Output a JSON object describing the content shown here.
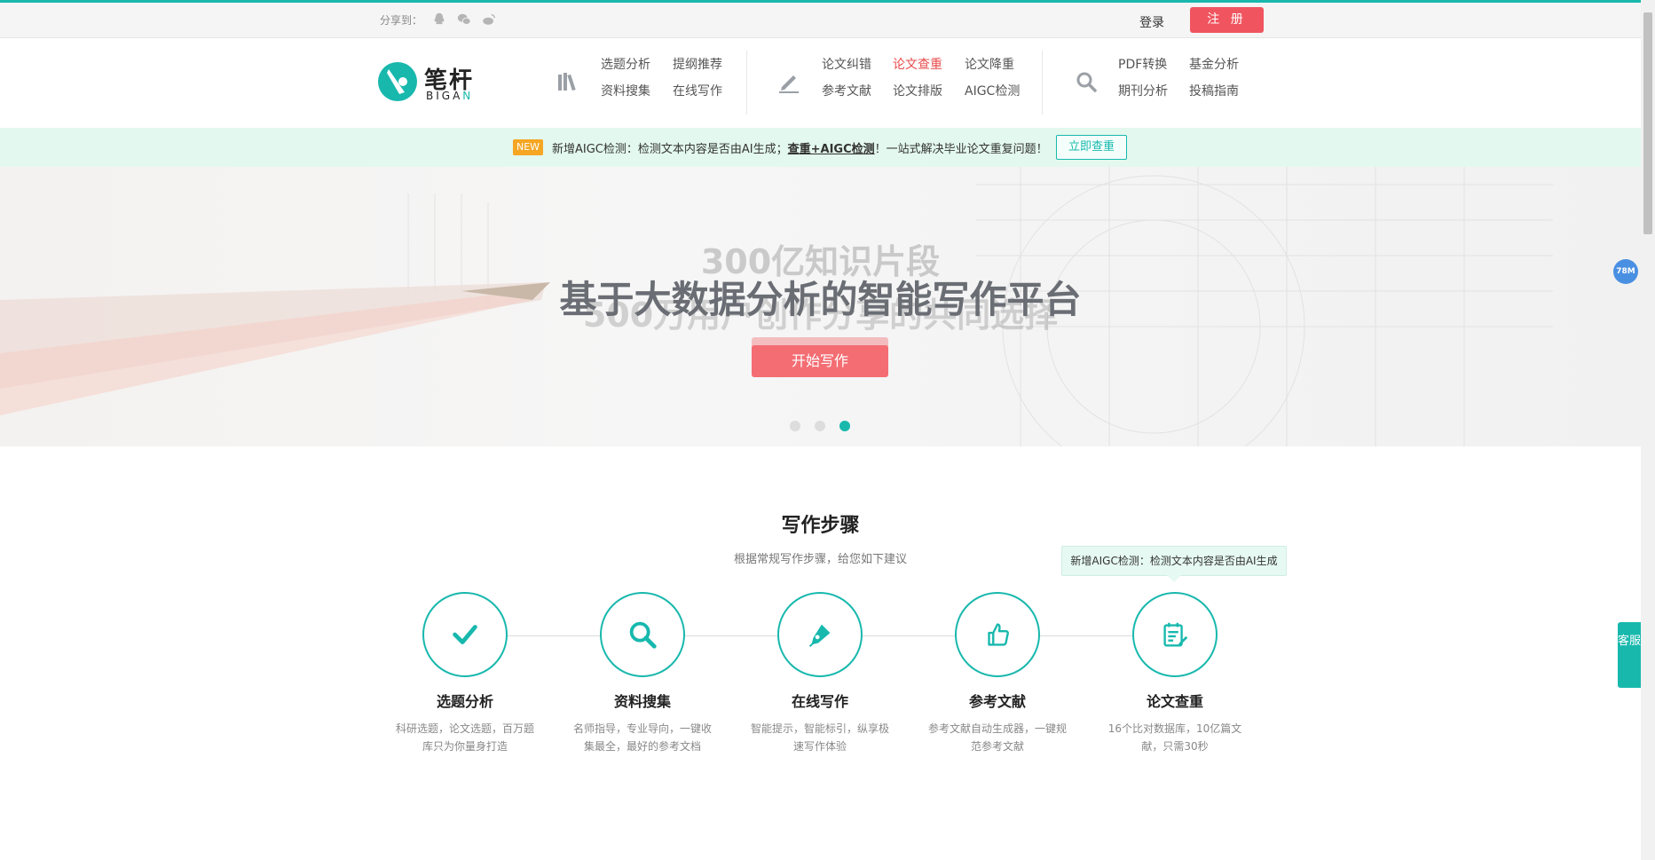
{
  "topbar": {
    "share_label": "分享到：",
    "login": "登录",
    "register": "注 册"
  },
  "logo": {
    "cn": "笔杆",
    "en_prefix": "BIGA",
    "en_suffix": "N"
  },
  "nav": {
    "group1": [
      "选题分析",
      "提纲推荐",
      "资料搜集",
      "在线写作"
    ],
    "group2": [
      "论文纠错",
      "论文查重",
      "论文降重",
      "参考文献",
      "论文排版",
      "AIGC检测"
    ],
    "group3": [
      "PDF转换",
      "基金分析",
      "期刊分析",
      "投稿指南"
    ],
    "active": "论文查重"
  },
  "notice": {
    "tag": "NEW",
    "text_before": "新增AIGC检测：检测文本内容是否由AI生成；",
    "text_bold": "查重+AIGC检测",
    "text_after": "！一站式解决毕业论文重复问题！",
    "button": "立即查重"
  },
  "hero": {
    "line1": "300亿知识片段",
    "line2": "基于大数据分析的智能写作平台",
    "line3": "500万用户创作分享的共同选择",
    "cta": "开始写作",
    "slides": 3,
    "active_slide": 3
  },
  "steps": {
    "title": "写作步骤",
    "subtitle": "根据常规写作步骤，给您如下建议",
    "tooltip": "新增AIGC检测：检测文本内容是否由AI生成",
    "items": [
      {
        "name": "选题分析",
        "desc": "科研选题，论文选题，百万题库只为你量身打造",
        "icon": "check-icon"
      },
      {
        "name": "资料搜集",
        "desc": "名师指导，专业导向，一键收集最全，最好的参考文档",
        "icon": "search-icon"
      },
      {
        "name": "在线写作",
        "desc": "智能提示，智能标引，纵享极速写作体验",
        "icon": "pen-icon"
      },
      {
        "name": "参考文献",
        "desc": "参考文献自动生成器，一键规范参考文献",
        "icon": "thumbs-up-icon"
      },
      {
        "name": "论文查重",
        "desc": "16个比对数据库，10亿篇文献，只需30秒",
        "icon": "document-edit-icon"
      }
    ]
  },
  "side": {
    "badge": "78M",
    "service": "客服"
  },
  "colors": {
    "accent": "#18b8ad",
    "register": "#f0555f",
    "active_nav": "#e84c4c"
  }
}
